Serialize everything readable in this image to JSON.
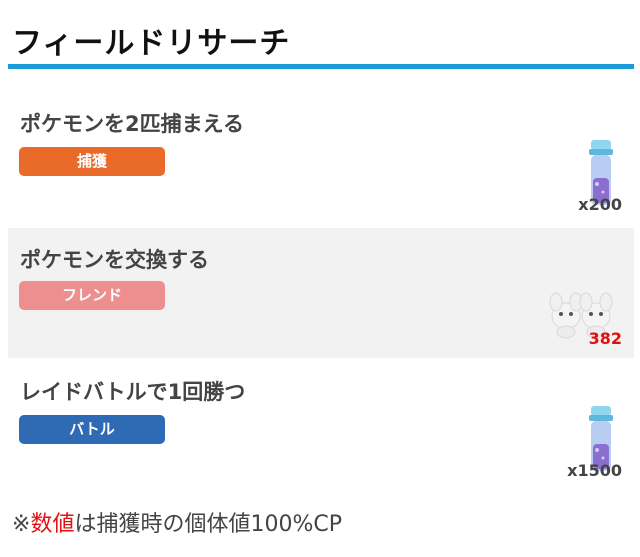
{
  "header": {
    "title": "フィールドリサーチ"
  },
  "colors": {
    "accent_rule": "#1a9bd7",
    "badge_capture": "#ea6a2a",
    "badge_friend": "#ee8f8f",
    "badge_battle": "#2f6bb5",
    "highlight_red": "#e21212"
  },
  "tasks": [
    {
      "text": "ポケモンを2匹捕まえる",
      "category": "捕獲",
      "reward_icon": "stardust-vial-icon",
      "reward_qty": "x200"
    },
    {
      "text": "ポケモンを交換する",
      "category": "フレンド",
      "reward_icon": "spinda-pair-icon",
      "reward_qty": "382"
    },
    {
      "text": "レイドバトルで1回勝つ",
      "category": "バトル",
      "reward_icon": "stardust-vial-icon",
      "reward_qty": "x1500"
    }
  ],
  "footnote": {
    "prefix": "※",
    "highlight": "数値",
    "rest": "は捕獲時の個体値100%CP"
  }
}
